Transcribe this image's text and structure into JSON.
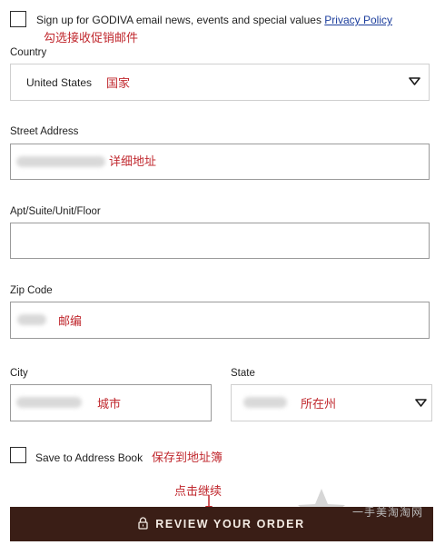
{
  "signup": {
    "text": "Sign up for GODIVA email news, events and special values",
    "link": "Privacy Policy",
    "checked": false,
    "annotation": "勾选接收促销邮件"
  },
  "country": {
    "label": "Country",
    "value": "United States",
    "annotation": "国家",
    "icon": "triangle-down-icon"
  },
  "street": {
    "label": "Street Address",
    "annotation": "详细地址"
  },
  "apt": {
    "label": "Apt/Suite/Unit/Floor",
    "value": ""
  },
  "zip": {
    "label": "Zip Code",
    "annotation": "邮编"
  },
  "city": {
    "label": "City",
    "annotation": "城市"
  },
  "state": {
    "label": "State",
    "annotation": "所在州",
    "icon": "triangle-down-icon"
  },
  "save_address": {
    "label": "Save to Address Book",
    "checked": false,
    "annotation": "保存到地址簿"
  },
  "review": {
    "label": "REVIEW YOUR ORDER",
    "annotation": "点击继续",
    "icon": "lock-icon",
    "background": "#3a1e16"
  },
  "watermark": {
    "text": "一手美淘淘网"
  },
  "colors": {
    "annotation": "#c0282e",
    "link": "#1b3d9c",
    "button": "#3a1e16"
  }
}
